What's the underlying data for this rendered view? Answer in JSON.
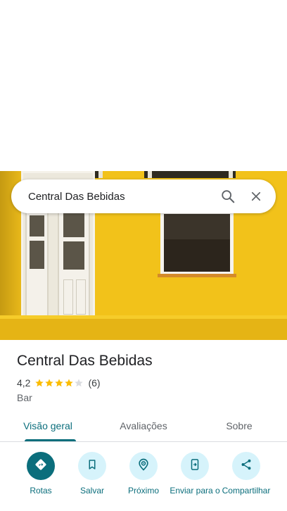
{
  "search": {
    "query": "Central Das Bebidas"
  },
  "place": {
    "title": "Central Das Bebidas",
    "rating": "4,2",
    "rating_value": 4.2,
    "review_count": "(6)",
    "category": "Bar"
  },
  "tabs": [
    {
      "label": "Visão geral",
      "active": true
    },
    {
      "label": "Avaliações",
      "active": false
    },
    {
      "label": "Sobre",
      "active": false
    }
  ],
  "actions": [
    {
      "label": "Rotas",
      "icon": "directions-icon"
    },
    {
      "label": "Salvar",
      "icon": "bookmark-icon"
    },
    {
      "label": "Próximo",
      "icon": "nearby-icon"
    },
    {
      "label": "Enviar para o",
      "icon": "send-to-phone-icon"
    },
    {
      "label": "Compartilhar",
      "icon": "share-icon"
    }
  ],
  "colors": {
    "accent": "#0b6e7c",
    "star": "#fbbc04",
    "star_empty": "#dadce0",
    "chip": "#d6f3fb",
    "wall": "#f2c21a"
  }
}
